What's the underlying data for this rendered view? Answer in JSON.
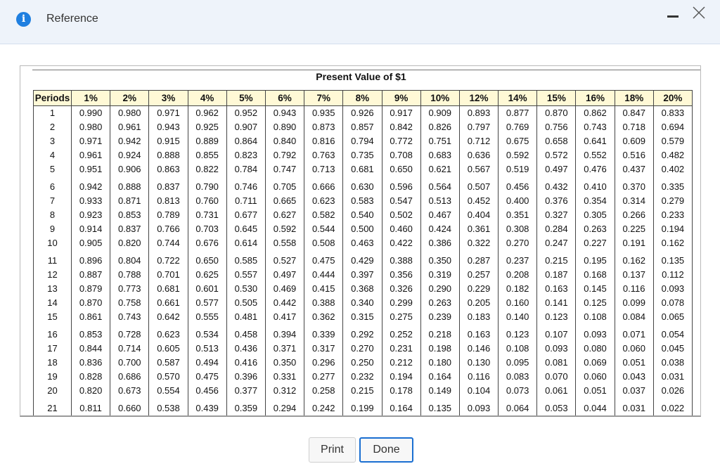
{
  "dialog": {
    "title": "Reference",
    "table_title": "Present Value of $1",
    "print_label": "Print",
    "done_label": "Done"
  },
  "table": {
    "headers": [
      "Periods",
      "1%",
      "2%",
      "3%",
      "4%",
      "5%",
      "6%",
      "7%",
      "8%",
      "9%",
      "10%",
      "12%",
      "14%",
      "15%",
      "16%",
      "18%",
      "20%"
    ],
    "rows": [
      [
        "1",
        "0.990",
        "0.980",
        "0.971",
        "0.962",
        "0.952",
        "0.943",
        "0.935",
        "0.926",
        "0.917",
        "0.909",
        "0.893",
        "0.877",
        "0.870",
        "0.862",
        "0.847",
        "0.833"
      ],
      [
        "2",
        "0.980",
        "0.961",
        "0.943",
        "0.925",
        "0.907",
        "0.890",
        "0.873",
        "0.857",
        "0.842",
        "0.826",
        "0.797",
        "0.769",
        "0.756",
        "0.743",
        "0.718",
        "0.694"
      ],
      [
        "3",
        "0.971",
        "0.942",
        "0.915",
        "0.889",
        "0.864",
        "0.840",
        "0.816",
        "0.794",
        "0.772",
        "0.751",
        "0.712",
        "0.675",
        "0.658",
        "0.641",
        "0.609",
        "0.579"
      ],
      [
        "4",
        "0.961",
        "0.924",
        "0.888",
        "0.855",
        "0.823",
        "0.792",
        "0.763",
        "0.735",
        "0.708",
        "0.683",
        "0.636",
        "0.592",
        "0.572",
        "0.552",
        "0.516",
        "0.482"
      ],
      [
        "5",
        "0.951",
        "0.906",
        "0.863",
        "0.822",
        "0.784",
        "0.747",
        "0.713",
        "0.681",
        "0.650",
        "0.621",
        "0.567",
        "0.519",
        "0.497",
        "0.476",
        "0.437",
        "0.402"
      ],
      [
        "6",
        "0.942",
        "0.888",
        "0.837",
        "0.790",
        "0.746",
        "0.705",
        "0.666",
        "0.630",
        "0.596",
        "0.564",
        "0.507",
        "0.456",
        "0.432",
        "0.410",
        "0.370",
        "0.335"
      ],
      [
        "7",
        "0.933",
        "0.871",
        "0.813",
        "0.760",
        "0.711",
        "0.665",
        "0.623",
        "0.583",
        "0.547",
        "0.513",
        "0.452",
        "0.400",
        "0.376",
        "0.354",
        "0.314",
        "0.279"
      ],
      [
        "8",
        "0.923",
        "0.853",
        "0.789",
        "0.731",
        "0.677",
        "0.627",
        "0.582",
        "0.540",
        "0.502",
        "0.467",
        "0.404",
        "0.351",
        "0.327",
        "0.305",
        "0.266",
        "0.233"
      ],
      [
        "9",
        "0.914",
        "0.837",
        "0.766",
        "0.703",
        "0.645",
        "0.592",
        "0.544",
        "0.500",
        "0.460",
        "0.424",
        "0.361",
        "0.308",
        "0.284",
        "0.263",
        "0.225",
        "0.194"
      ],
      [
        "10",
        "0.905",
        "0.820",
        "0.744",
        "0.676",
        "0.614",
        "0.558",
        "0.508",
        "0.463",
        "0.422",
        "0.386",
        "0.322",
        "0.270",
        "0.247",
        "0.227",
        "0.191",
        "0.162"
      ],
      [
        "11",
        "0.896",
        "0.804",
        "0.722",
        "0.650",
        "0.585",
        "0.527",
        "0.475",
        "0.429",
        "0.388",
        "0.350",
        "0.287",
        "0.237",
        "0.215",
        "0.195",
        "0.162",
        "0.135"
      ],
      [
        "12",
        "0.887",
        "0.788",
        "0.701",
        "0.625",
        "0.557",
        "0.497",
        "0.444",
        "0.397",
        "0.356",
        "0.319",
        "0.257",
        "0.208",
        "0.187",
        "0.168",
        "0.137",
        "0.112"
      ],
      [
        "13",
        "0.879",
        "0.773",
        "0.681",
        "0.601",
        "0.530",
        "0.469",
        "0.415",
        "0.368",
        "0.326",
        "0.290",
        "0.229",
        "0.182",
        "0.163",
        "0.145",
        "0.116",
        "0.093"
      ],
      [
        "14",
        "0.870",
        "0.758",
        "0.661",
        "0.577",
        "0.505",
        "0.442",
        "0.388",
        "0.340",
        "0.299",
        "0.263",
        "0.205",
        "0.160",
        "0.141",
        "0.125",
        "0.099",
        "0.078"
      ],
      [
        "15",
        "0.861",
        "0.743",
        "0.642",
        "0.555",
        "0.481",
        "0.417",
        "0.362",
        "0.315",
        "0.275",
        "0.239",
        "0.183",
        "0.140",
        "0.123",
        "0.108",
        "0.084",
        "0.065"
      ],
      [
        "16",
        "0.853",
        "0.728",
        "0.623",
        "0.534",
        "0.458",
        "0.394",
        "0.339",
        "0.292",
        "0.252",
        "0.218",
        "0.163",
        "0.123",
        "0.107",
        "0.093",
        "0.071",
        "0.054"
      ],
      [
        "17",
        "0.844",
        "0.714",
        "0.605",
        "0.513",
        "0.436",
        "0.371",
        "0.317",
        "0.270",
        "0.231",
        "0.198",
        "0.146",
        "0.108",
        "0.093",
        "0.080",
        "0.060",
        "0.045"
      ],
      [
        "18",
        "0.836",
        "0.700",
        "0.587",
        "0.494",
        "0.416",
        "0.350",
        "0.296",
        "0.250",
        "0.212",
        "0.180",
        "0.130",
        "0.095",
        "0.081",
        "0.069",
        "0.051",
        "0.038"
      ],
      [
        "19",
        "0.828",
        "0.686",
        "0.570",
        "0.475",
        "0.396",
        "0.331",
        "0.277",
        "0.232",
        "0.194",
        "0.164",
        "0.116",
        "0.083",
        "0.070",
        "0.060",
        "0.043",
        "0.031"
      ],
      [
        "20",
        "0.820",
        "0.673",
        "0.554",
        "0.456",
        "0.377",
        "0.312",
        "0.258",
        "0.215",
        "0.178",
        "0.149",
        "0.104",
        "0.073",
        "0.061",
        "0.051",
        "0.037",
        "0.026"
      ],
      [
        "21",
        "0.811",
        "0.660",
        "0.538",
        "0.439",
        "0.359",
        "0.294",
        "0.242",
        "0.199",
        "0.164",
        "0.135",
        "0.093",
        "0.064",
        "0.053",
        "0.044",
        "0.031",
        "0.022"
      ]
    ]
  },
  "icons": {
    "info": "info-icon",
    "minimize": "minimize-icon",
    "close": "close-icon"
  },
  "colors": {
    "header_bg": "#fff9d6",
    "titlebar_bg": "#eef3fa",
    "accent": "#1a6fd1"
  }
}
